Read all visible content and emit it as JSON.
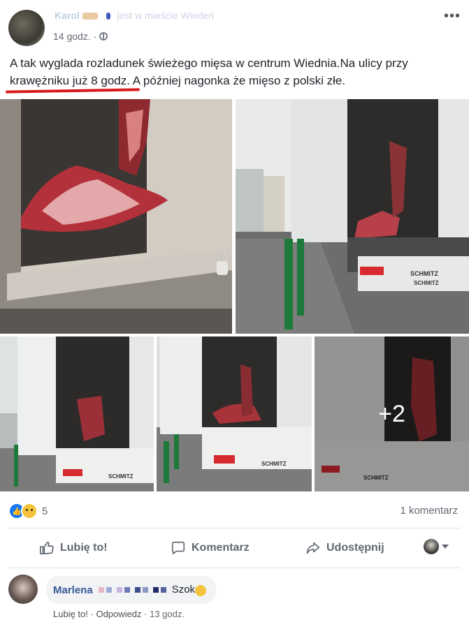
{
  "post": {
    "author": "Karol",
    "author_suffix": "jest w mieście Wiedeń",
    "time": "14 godz.",
    "text": "A tak wyglada rozladunek świeżego mięsa w centrum Wiednia.Na ulicy przy krawężniku już 8 godz. A później nagonka że mięso z polski złe.",
    "more_images_label": "+2",
    "photo_text": {
      "trailer_brand": "SCHMITZ"
    }
  },
  "reactions": {
    "count": "5"
  },
  "comments_count": "1 komentarz",
  "actions": {
    "like": "Lubię to!",
    "comment": "Komentarz",
    "share": "Udostępnij"
  },
  "comment": {
    "author": "Marlena",
    "text": "Szok",
    "like": "Lubię to!",
    "reply": "Odpowiedz",
    "time": "13 godz.",
    "separator": "·"
  },
  "colors": {
    "link_blue": "#385898",
    "like_blue": "#1877f2",
    "underline_red": "#d81a1a"
  }
}
